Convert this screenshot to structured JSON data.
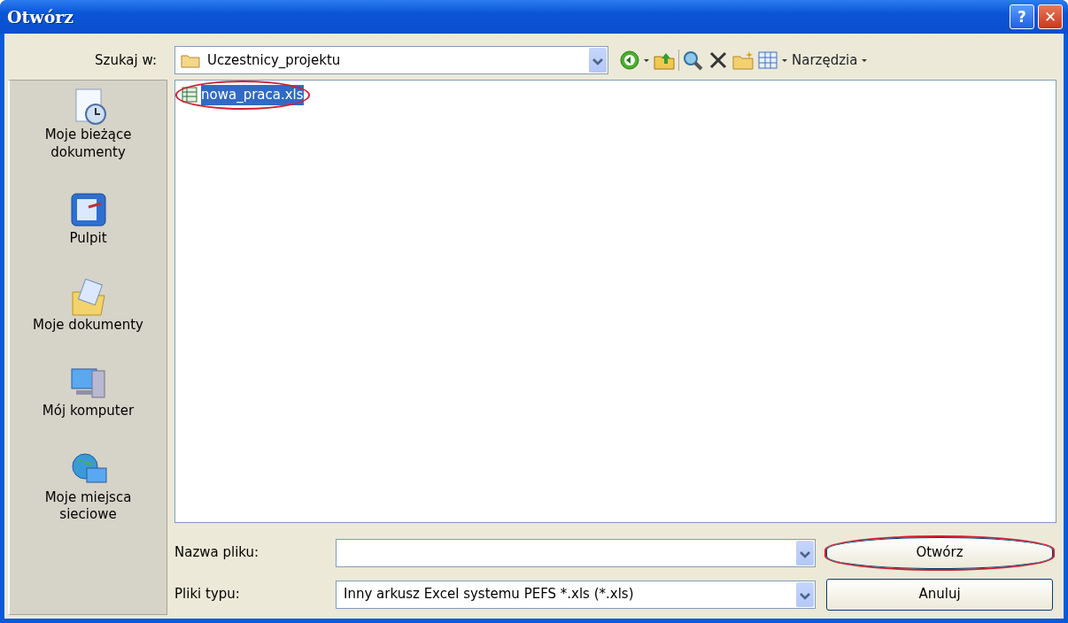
{
  "window": {
    "title": "Otwórz",
    "title_buttons": [
      "?",
      "✕"
    ]
  },
  "look_in": {
    "label": "Szukaj w:",
    "value": "Uczestnicy_projektu"
  },
  "toolbar": {
    "tools_label": "Narzędzia"
  },
  "places": [
    {
      "label": "Moje bieżące dokumenty",
      "kind": "recent"
    },
    {
      "label": "Pulpit",
      "kind": "desktop"
    },
    {
      "label": "Moje dokumenty",
      "kind": "documents"
    },
    {
      "label": "Mój komputer",
      "kind": "computer"
    },
    {
      "label": "Moje miejsca sieciowe",
      "kind": "network"
    }
  ],
  "files": [
    {
      "name": "nowa_praca.xls",
      "selected": true,
      "highlighted": true
    }
  ],
  "file_name": {
    "label": "Nazwa pliku:"
  },
  "file_type": {
    "label": "Pliki typu:",
    "value": "Inny arkusz Excel systemu PEFS *.xls (*.xls)"
  },
  "buttons": [
    {
      "label": "Otwórz",
      "highlighted": true
    },
    {
      "label": "Anuluj",
      "highlighted": false
    }
  ]
}
